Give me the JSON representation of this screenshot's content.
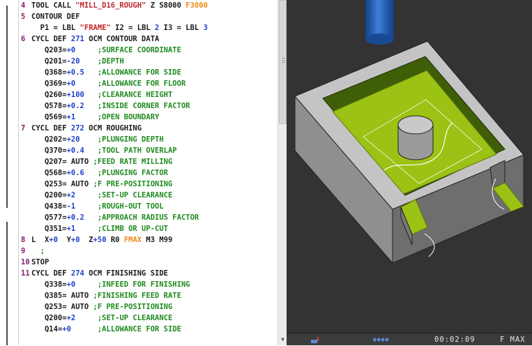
{
  "editor": {
    "lines": [
      {
        "num": "4",
        "parts": [
          {
            "t": "TOOL CALL ",
            "c": "black"
          },
          {
            "t": "\"MILL_D16_ROUGH\"",
            "c": "red"
          },
          {
            "t": " Z S8000 ",
            "c": "black"
          },
          {
            "t": "F3000",
            "c": "orange"
          }
        ]
      },
      {
        "num": "5",
        "parts": [
          {
            "t": "CONTOUR DEF",
            "c": "black"
          }
        ]
      },
      {
        "num": "",
        "parts": [
          {
            "t": "  P1 = LBL ",
            "c": "black"
          },
          {
            "t": "\"FRAME\"",
            "c": "red"
          },
          {
            "t": " I2 = LBL ",
            "c": "black"
          },
          {
            "t": "2",
            "c": "blue"
          },
          {
            "t": " I3 = LBL ",
            "c": "black"
          },
          {
            "t": "3",
            "c": "blue"
          }
        ]
      },
      {
        "num": "6",
        "parts": [
          {
            "t": "CYCL DEF ",
            "c": "black"
          },
          {
            "t": "271",
            "c": "blue"
          },
          {
            "t": " OCM CONTOUR DATA",
            "c": "black"
          }
        ]
      },
      {
        "num": "",
        "parts": [
          {
            "t": "   Q203=",
            "c": "black"
          },
          {
            "t": "+0",
            "c": "blue"
          },
          {
            "t": "     ;SURFACE COORDINATE",
            "c": "green"
          }
        ]
      },
      {
        "num": "",
        "parts": [
          {
            "t": "   Q201=",
            "c": "black"
          },
          {
            "t": "-20",
            "c": "blue"
          },
          {
            "t": "    ;DEPTH",
            "c": "green"
          }
        ]
      },
      {
        "num": "",
        "parts": [
          {
            "t": "   Q368=",
            "c": "black"
          },
          {
            "t": "+0.5",
            "c": "blue"
          },
          {
            "t": "   ;ALLOWANCE FOR SIDE",
            "c": "green"
          }
        ]
      },
      {
        "num": "",
        "parts": [
          {
            "t": "   Q369=",
            "c": "black"
          },
          {
            "t": "+0",
            "c": "blue"
          },
          {
            "t": "     ;ALLOWANCE FOR FLOOR",
            "c": "green"
          }
        ]
      },
      {
        "num": "",
        "parts": [
          {
            "t": "   Q260=",
            "c": "black"
          },
          {
            "t": "+100",
            "c": "blue"
          },
          {
            "t": "   ;CLEARANCE HEIGHT",
            "c": "green"
          }
        ]
      },
      {
        "num": "",
        "parts": [
          {
            "t": "   Q578=",
            "c": "black"
          },
          {
            "t": "+0.2",
            "c": "blue"
          },
          {
            "t": "   ;INSIDE CORNER FACTOR",
            "c": "green"
          }
        ]
      },
      {
        "num": "",
        "parts": [
          {
            "t": "   Q569=",
            "c": "black"
          },
          {
            "t": "+1",
            "c": "blue"
          },
          {
            "t": "     ;OPEN BOUNDARY",
            "c": "green"
          }
        ]
      },
      {
        "num": "7",
        "parts": [
          {
            "t": "CYCL DEF ",
            "c": "black"
          },
          {
            "t": "272",
            "c": "blue"
          },
          {
            "t": " OCM ROUGHING",
            "c": "black"
          }
        ]
      },
      {
        "num": "",
        "parts": [
          {
            "t": "   Q202=",
            "c": "black"
          },
          {
            "t": "+20",
            "c": "blue"
          },
          {
            "t": "    ;PLUNGING DEPTH",
            "c": "green"
          }
        ]
      },
      {
        "num": "",
        "parts": [
          {
            "t": "   Q370=",
            "c": "black"
          },
          {
            "t": "+0.4",
            "c": "blue"
          },
          {
            "t": "   ;TOOL PATH OVERLAP",
            "c": "green"
          }
        ]
      },
      {
        "num": "",
        "parts": [
          {
            "t": "   Q207= AUTO ",
            "c": "black"
          },
          {
            "t": ";FEED RATE MILLING",
            "c": "green"
          }
        ]
      },
      {
        "num": "",
        "parts": [
          {
            "t": "   Q568=",
            "c": "black"
          },
          {
            "t": "+0.6",
            "c": "blue"
          },
          {
            "t": "   ;PLUNGING FACTOR",
            "c": "green"
          }
        ]
      },
      {
        "num": "",
        "parts": [
          {
            "t": "   Q253= AUTO ",
            "c": "black"
          },
          {
            "t": ";F PRE-POSITIONING",
            "c": "green"
          }
        ]
      },
      {
        "num": "",
        "parts": [
          {
            "t": "   Q200=",
            "c": "black"
          },
          {
            "t": "+2",
            "c": "blue"
          },
          {
            "t": "     ;SET-UP CLEARANCE",
            "c": "green"
          }
        ]
      },
      {
        "num": "",
        "parts": [
          {
            "t": "   Q438=",
            "c": "black"
          },
          {
            "t": "-1",
            "c": "blue"
          },
          {
            "t": "     ;ROUGH-OUT TOOL",
            "c": "green"
          }
        ]
      },
      {
        "num": "",
        "parts": [
          {
            "t": "   Q577=",
            "c": "black"
          },
          {
            "t": "+0.2",
            "c": "blue"
          },
          {
            "t": "   ;APPROACH RADIUS FACTOR",
            "c": "green"
          }
        ]
      },
      {
        "num": "",
        "parts": [
          {
            "t": "   Q351=",
            "c": "black"
          },
          {
            "t": "+1",
            "c": "blue"
          },
          {
            "t": "     ;CLIMB OR UP-CUT",
            "c": "green"
          }
        ]
      },
      {
        "num": "8",
        "parts": [
          {
            "t": "L  X",
            "c": "black"
          },
          {
            "t": "+0",
            "c": "blue"
          },
          {
            "t": "  Y",
            "c": "black"
          },
          {
            "t": "+0",
            "c": "blue"
          },
          {
            "t": "  Z",
            "c": "black"
          },
          {
            "t": "+50",
            "c": "blue"
          },
          {
            "t": " R0 ",
            "c": "black"
          },
          {
            "t": "FMAX",
            "c": "orange"
          },
          {
            "t": " M3 M99",
            "c": "black"
          }
        ]
      },
      {
        "num": "9",
        "parts": [
          {
            "t": "  ;",
            "c": "green"
          }
        ]
      },
      {
        "num": "10",
        "parts": [
          {
            "t": "STOP",
            "c": "black"
          }
        ]
      },
      {
        "num": "11",
        "parts": [
          {
            "t": "CYCL DEF ",
            "c": "black"
          },
          {
            "t": "274",
            "c": "blue"
          },
          {
            "t": " OCM FINISHING SIDE",
            "c": "black"
          }
        ]
      },
      {
        "num": "",
        "parts": [
          {
            "t": "   Q338=",
            "c": "black"
          },
          {
            "t": "+0",
            "c": "blue"
          },
          {
            "t": "     ;INFEED FOR FINISHING",
            "c": "green"
          }
        ]
      },
      {
        "num": "",
        "parts": [
          {
            "t": "   Q385= AUTO ",
            "c": "black"
          },
          {
            "t": ";FINISHING FEED RATE",
            "c": "green"
          }
        ]
      },
      {
        "num": "",
        "parts": [
          {
            "t": "   Q253= AUTO ",
            "c": "black"
          },
          {
            "t": ";F PRE-POSITIONING",
            "c": "green"
          }
        ]
      },
      {
        "num": "",
        "parts": [
          {
            "t": "   Q200=",
            "c": "black"
          },
          {
            "t": "+2",
            "c": "blue"
          },
          {
            "t": "     ;SET-UP CLEARANCE",
            "c": "green"
          }
        ]
      },
      {
        "num": "",
        "parts": [
          {
            "t": "   Q14=",
            "c": "black"
          },
          {
            "t": "+0",
            "c": "blue"
          },
          {
            "t": "      ;ALLOWANCE FOR SIDE",
            "c": "green"
          }
        ]
      }
    ]
  },
  "status": {
    "time": "00:02:09",
    "feed": "F MAX",
    "dots": "●●●●",
    "sim_icon": "tool-simulation-icon"
  },
  "colors": {
    "keyword": "#1a1a1a",
    "number": "#1f3fc8",
    "comment": "#1f8a1f",
    "string": "#c0282b",
    "feed": "#ef8a1a",
    "line_number": "#8a1b6e",
    "workpiece_floor": "#9bc214",
    "workpiece_gray": "#bdbdbd",
    "tool": "#1f5fb8",
    "viewport_bg": "#333333"
  }
}
